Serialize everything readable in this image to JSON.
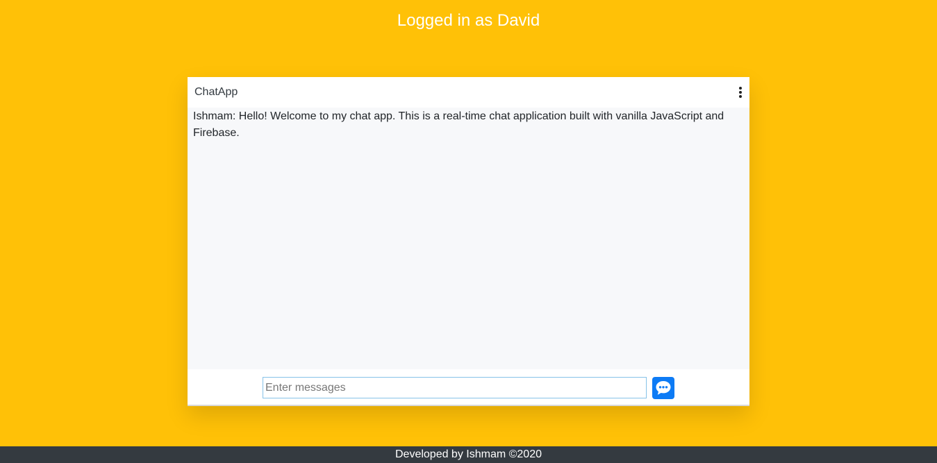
{
  "header": {
    "login_status": "Logged in as David"
  },
  "chat": {
    "title": "ChatApp",
    "menu_icon": "vertical-ellipsis-icon",
    "messages": [
      {
        "text": "Ishmam: Hello! Welcome to my chat app. This is a real-time chat application built with vanilla JavaScript and Firebase."
      }
    ],
    "input": {
      "placeholder": "Enter messages",
      "value": ""
    },
    "send_icon": "chat-bubble-icon"
  },
  "footer": {
    "text": "Developed by Ishmam ©2020"
  },
  "colors": {
    "background": "#ffc107",
    "footer": "#343a40",
    "send_button": "#0d7bf5",
    "messages_area": "#f7f8fa"
  }
}
